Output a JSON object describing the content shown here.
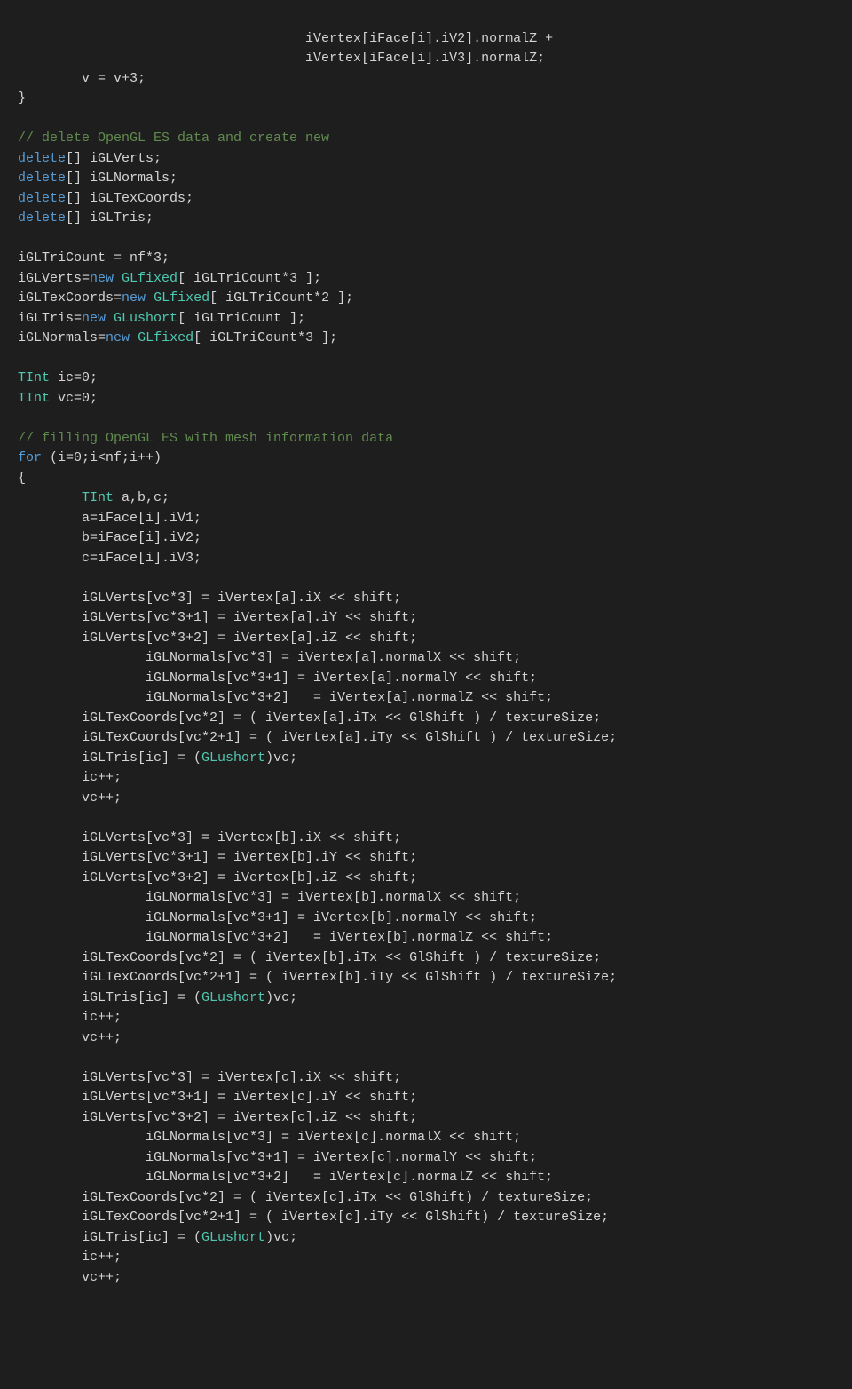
{
  "code": {
    "lines": [
      {
        "type": "plain",
        "text": "                                    iVertex[iFace[i].iV2].normalZ +"
      },
      {
        "type": "plain",
        "text": "                                    iVertex[iFace[i].iV3].normalZ;"
      },
      {
        "type": "plain",
        "text": "        v = v+3;"
      },
      {
        "type": "plain",
        "text": "}"
      },
      {
        "type": "plain",
        "text": ""
      },
      {
        "type": "comment",
        "text": "// delete OpenGL ES data and create new"
      },
      {
        "type": "plain",
        "text": "delete[] iGLVerts;"
      },
      {
        "type": "plain",
        "text": "delete[] iGLNormals;"
      },
      {
        "type": "plain",
        "text": "delete[] iGLTexCoords;"
      },
      {
        "type": "plain",
        "text": "delete[] iGLTris;"
      },
      {
        "type": "plain",
        "text": ""
      },
      {
        "type": "plain",
        "text": "iGLTriCount = nf*3;"
      },
      {
        "type": "plain",
        "text": "iGLVerts=new GLfixed[ iGLTriCount*3 ];"
      },
      {
        "type": "plain",
        "text": "iGLTexCoords=new GLfixed[ iGLTriCount*2 ];"
      },
      {
        "type": "plain",
        "text": "iGLTris=new GLushort[ iGLTriCount ];"
      },
      {
        "type": "plain",
        "text": "iGLNormals=new GLfixed[ iGLTriCount*3 ];"
      },
      {
        "type": "plain",
        "text": ""
      },
      {
        "type": "plain",
        "text": "TInt ic=0;"
      },
      {
        "type": "plain",
        "text": "TInt vc=0;"
      },
      {
        "type": "plain",
        "text": ""
      },
      {
        "type": "comment",
        "text": "// filling OpenGL ES with mesh information data"
      },
      {
        "type": "plain",
        "text": "for (i=0;i<nf;i++)"
      },
      {
        "type": "plain",
        "text": "{"
      },
      {
        "type": "plain",
        "text": "        TInt a,b,c;"
      },
      {
        "type": "plain",
        "text": "        a=iFace[i].iV1;"
      },
      {
        "type": "plain",
        "text": "        b=iFace[i].iV2;"
      },
      {
        "type": "plain",
        "text": "        c=iFace[i].iV3;"
      },
      {
        "type": "plain",
        "text": ""
      },
      {
        "type": "plain",
        "text": "        iGLVerts[vc*3] = iVertex[a].iX << shift;"
      },
      {
        "type": "plain",
        "text": "        iGLVerts[vc*3+1] = iVertex[a].iY << shift;"
      },
      {
        "type": "plain",
        "text": "        iGLVerts[vc*3+2] = iVertex[a].iZ << shift;"
      },
      {
        "type": "plain",
        "text": "                iGLNormals[vc*3] = iVertex[a].normalX << shift;"
      },
      {
        "type": "plain",
        "text": "                iGLNormals[vc*3+1] = iVertex[a].normalY << shift;"
      },
      {
        "type": "plain",
        "text": "                iGLNormals[vc*3+2]   = iVertex[a].normalZ << shift;"
      },
      {
        "type": "plain",
        "text": "        iGLTexCoords[vc*2] = ( iVertex[a].iTx << GlShift ) / textureSize;"
      },
      {
        "type": "plain",
        "text": "        iGLTexCoords[vc*2+1] = ( iVertex[a].iTy << GlShift ) / textureSize;"
      },
      {
        "type": "plain",
        "text": "        iGLTris[ic] = (GLushort)vc;"
      },
      {
        "type": "plain",
        "text": "        ic++;"
      },
      {
        "type": "plain",
        "text": "        vc++;"
      },
      {
        "type": "plain",
        "text": ""
      },
      {
        "type": "plain",
        "text": "        iGLVerts[vc*3] = iVertex[b].iX << shift;"
      },
      {
        "type": "plain",
        "text": "        iGLVerts[vc*3+1] = iVertex[b].iY << shift;"
      },
      {
        "type": "plain",
        "text": "        iGLVerts[vc*3+2] = iVertex[b].iZ << shift;"
      },
      {
        "type": "plain",
        "text": "                iGLNormals[vc*3] = iVertex[b].normalX << shift;"
      },
      {
        "type": "plain",
        "text": "                iGLNormals[vc*3+1] = iVertex[b].normalY << shift;"
      },
      {
        "type": "plain",
        "text": "                iGLNormals[vc*3+2]   = iVertex[b].normalZ << shift;"
      },
      {
        "type": "plain",
        "text": "        iGLTexCoords[vc*2] = ( iVertex[b].iTx << GlShift ) / textureSize;"
      },
      {
        "type": "plain",
        "text": "        iGLTexCoords[vc*2+1] = ( iVertex[b].iTy << GlShift ) / textureSize;"
      },
      {
        "type": "plain",
        "text": "        iGLTris[ic] = (GLushort)vc;"
      },
      {
        "type": "plain",
        "text": "        ic++;"
      },
      {
        "type": "plain",
        "text": "        vc++;"
      },
      {
        "type": "plain",
        "text": ""
      },
      {
        "type": "plain",
        "text": "        iGLVerts[vc*3] = iVertex[c].iX << shift;"
      },
      {
        "type": "plain",
        "text": "        iGLVerts[vc*3+1] = iVertex[c].iY << shift;"
      },
      {
        "type": "plain",
        "text": "        iGLVerts[vc*3+2] = iVertex[c].iZ << shift;"
      },
      {
        "type": "plain",
        "text": "                iGLNormals[vc*3] = iVertex[c].normalX << shift;"
      },
      {
        "type": "plain",
        "text": "                iGLNormals[vc*3+1] = iVertex[c].normalY << shift;"
      },
      {
        "type": "plain",
        "text": "                iGLNormals[vc*3+2]   = iVertex[c].normalZ << shift;"
      },
      {
        "type": "plain",
        "text": "        iGLTexCoords[vc*2] = ( iVertex[c].iTx << GlShift) / textureSize;"
      },
      {
        "type": "plain",
        "text": "        iGLTexCoords[vc*2+1] = ( iVertex[c].iTy << GlShift) / textureSize;"
      },
      {
        "type": "plain",
        "text": "        iGLTris[ic] = (GLushort)vc;"
      },
      {
        "type": "plain",
        "text": "        ic++;"
      },
      {
        "type": "plain",
        "text": "        vc++;"
      }
    ]
  }
}
